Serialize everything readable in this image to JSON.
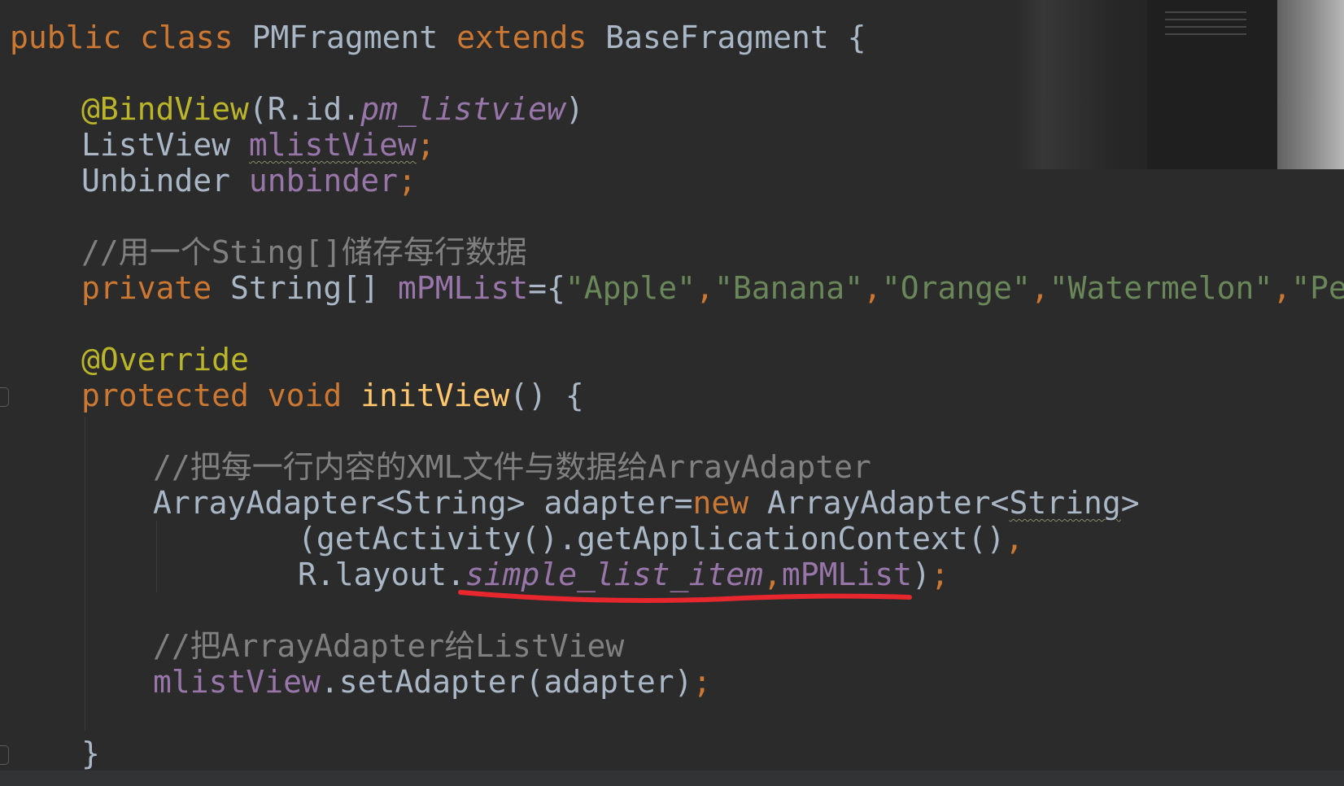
{
  "code": {
    "class_decl": {
      "kw_public": "public",
      "kw_class": "class",
      "class_name": "PMFragment",
      "kw_extends": "extends",
      "super_name": "BaseFragment",
      "brace": "{"
    },
    "bind_annotation": {
      "ann": "@BindView",
      "open": "(R.id.",
      "id": "pm_listview",
      "close": ")"
    },
    "field_listview": {
      "type": "ListView",
      "name": "mlistView",
      "semi": ";"
    },
    "field_unbinder": {
      "type": "Unbinder",
      "name": "unbinder",
      "semi": ";"
    },
    "comment_1": "//用一个Sting[]储存每行数据",
    "array_decl": {
      "kw_private": "private",
      "type": "String[]",
      "name": "mPMList",
      "assign": "={",
      "items": [
        "\"Apple\"",
        "\"Banana\"",
        "\"Orange\"",
        "\"Watermelon\"",
        "\"Pear\""
      ],
      "comma": ","
    },
    "override_annotation": "@Override",
    "method_decl": {
      "kw_protected": "protected",
      "kw_void": "void",
      "name": "initView",
      "rest": "() {"
    },
    "comment_2": "//把每一行内容的XML文件与数据给ArrayAdapter",
    "adapter_line": {
      "type": "ArrayAdapter<String>",
      "var": "adapter=",
      "kw_new": "new",
      "ctor": "ArrayAdapter<",
      "generic": "String",
      "end": ">"
    },
    "context_line": {
      "call": "(getActivity().getApplicationContext()",
      "comma": ","
    },
    "layout_line": {
      "prefix": "R.layout.",
      "layout_id": "simple_list_item",
      "comma": ",",
      "list_ref": "mPMList",
      "close": ")",
      "semi": ";"
    },
    "comment_3": "//把ArrayAdapter给ListView",
    "set_adapter_line": {
      "ref": "mlistView",
      "call": ".setAdapter(adapter)",
      "semi": ";"
    },
    "method_close": "}"
  },
  "colors": {
    "background": "#2b2b2b",
    "keyword": "#cc7832",
    "annotation": "#bbb529",
    "field": "#9876aa",
    "string": "#6a8759",
    "comment": "#808080",
    "method": "#ffc66d",
    "default_text": "#a9b7c6",
    "red_underline": "#e8262e"
  }
}
